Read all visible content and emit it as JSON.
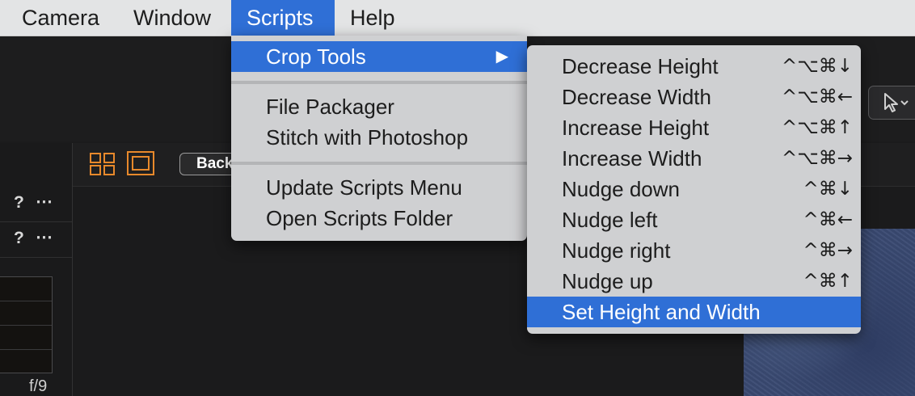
{
  "menubar": {
    "items": [
      {
        "label": "Camera"
      },
      {
        "label": "Window"
      },
      {
        "label": "Scripts"
      },
      {
        "label": "Help"
      }
    ]
  },
  "scripts_menu": {
    "crop_tools": {
      "label": "Crop Tools",
      "arrow": "▶"
    },
    "file_packager": {
      "label": "File Packager"
    },
    "stitch": {
      "label": "Stitch with Photoshop"
    },
    "update_menu": {
      "label": "Update Scripts Menu"
    },
    "open_folder": {
      "label": "Open Scripts Folder"
    }
  },
  "crop_submenu": {
    "items": [
      {
        "label": "Decrease Height",
        "shortcut": "^⌥⌘↓"
      },
      {
        "label": "Decrease Width",
        "shortcut": "^⌥⌘←"
      },
      {
        "label": "Increase Height",
        "shortcut": "^⌥⌘↑"
      },
      {
        "label": "Increase Width",
        "shortcut": "^⌥⌘→"
      },
      {
        "label": "Nudge down",
        "shortcut": "^⌘↓"
      },
      {
        "label": "Nudge left",
        "shortcut": "^⌘←"
      },
      {
        "label": "Nudge right",
        "shortcut": "^⌘→"
      },
      {
        "label": "Nudge up",
        "shortcut": "^⌘↑"
      },
      {
        "label": "Set Height and Width",
        "shortcut": ""
      }
    ]
  },
  "background": {
    "panel_q": "?",
    "panel_dots": "⋯",
    "back_button": "Back",
    "fstop": "f/9"
  },
  "colors": {
    "highlight": "#2f6fd6",
    "menu_bg": "#cfd0d2",
    "accent_orange": "#e8892b"
  }
}
